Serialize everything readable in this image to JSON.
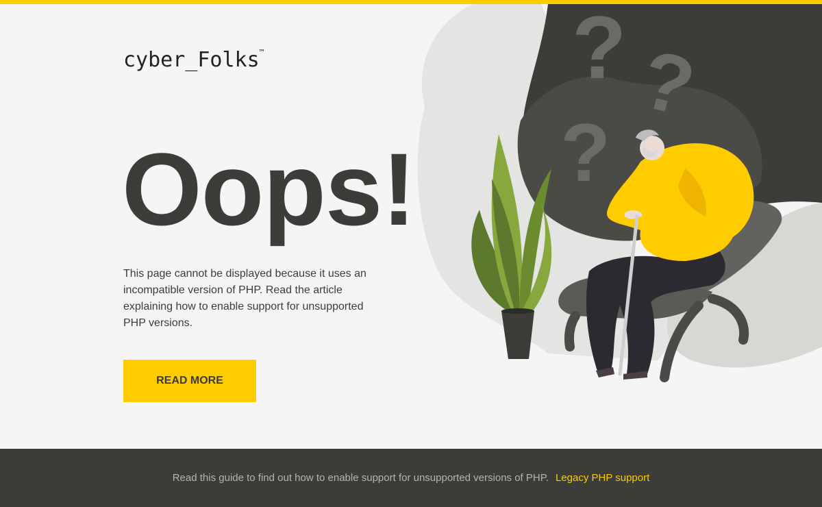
{
  "brand": {
    "logo_text": "cyber_Folks",
    "trademark": "™"
  },
  "hero": {
    "headline": "Oops!",
    "description": "This page cannot be displayed because it uses an incompatible version of PHP. Read the article explaining how to enable support for unsupported PHP versions.",
    "button_label": "READ MORE"
  },
  "illustration": {
    "question_mark": "?",
    "icons": [
      "question-mark-icon",
      "plant-icon",
      "elderly-man-icon",
      "armchair-icon",
      "cane-icon"
    ]
  },
  "footer": {
    "text": "Read this guide to find out how to enable support for unsupported versions of PHP.",
    "link_label": "Legacy PHP support"
  },
  "colors": {
    "accent": "#ffcc00",
    "dark": "#3c3c38",
    "background": "#f5f5f5",
    "footer_text": "#b5b5b0"
  }
}
